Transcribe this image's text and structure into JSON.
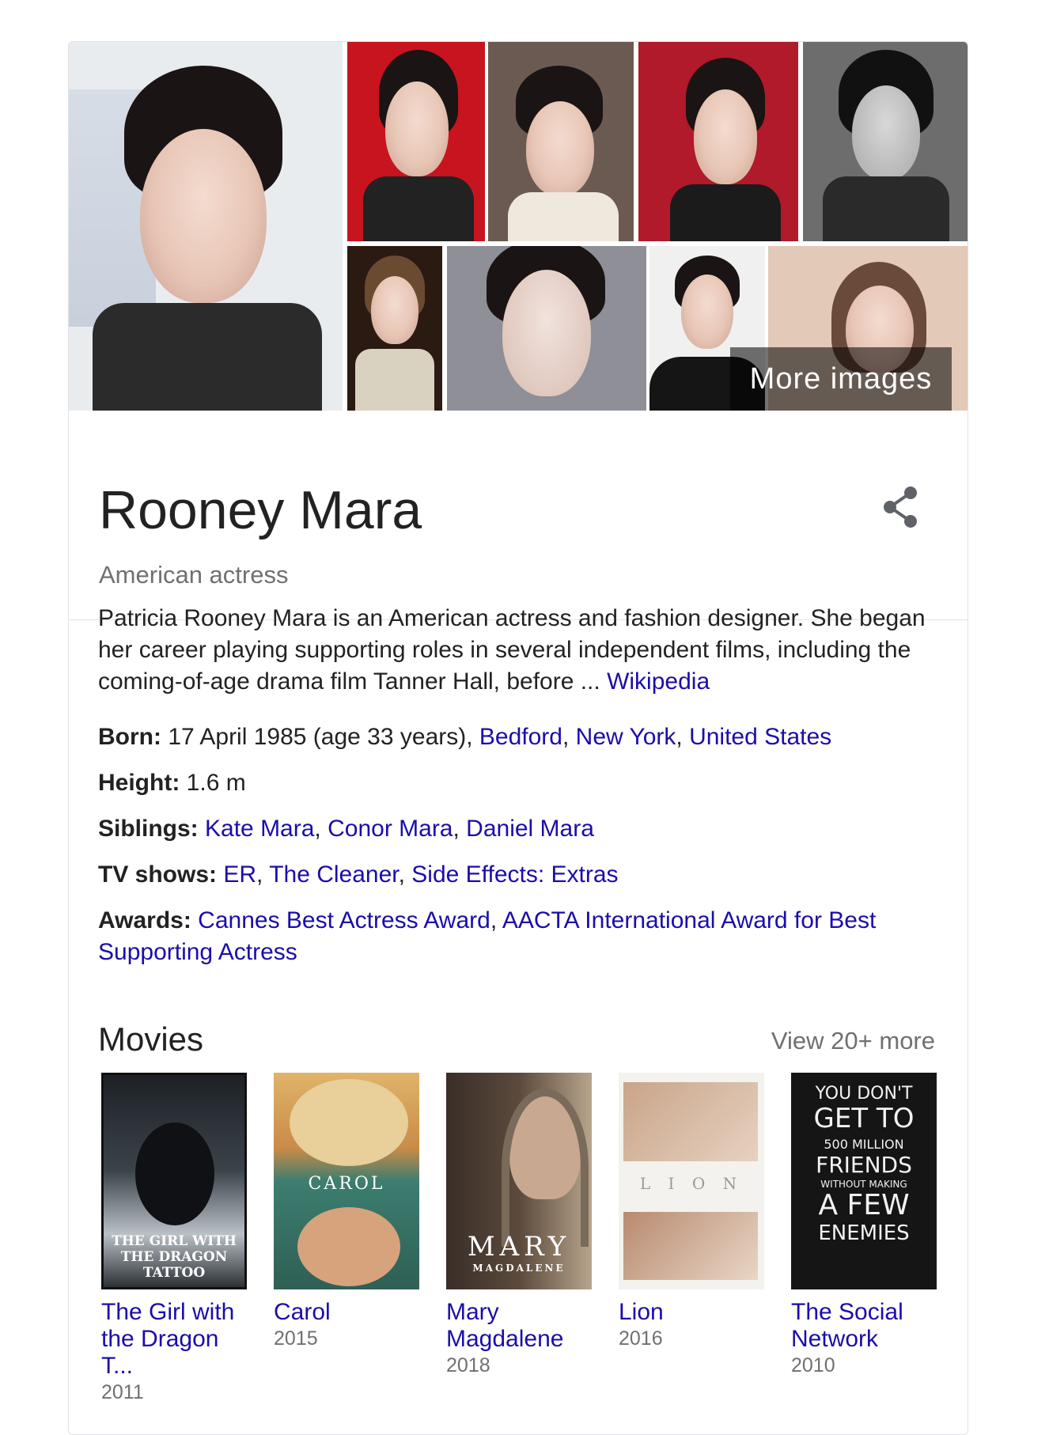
{
  "gallery": {
    "more_images_label": "More images"
  },
  "entity": {
    "name": "Rooney Mara",
    "subtitle": "American actress"
  },
  "description": {
    "text": "Patricia Rooney Mara is an American actress and fashion designer. She began her career playing supporting roles in several independent films, including the coming-of-age drama film Tanner Hall, before ... ",
    "source_link": "Wikipedia"
  },
  "facts": {
    "born": {
      "label": "Born:",
      "value": "17 April 1985 (age 33 years), ",
      "place_links": [
        "Bedford",
        "New York",
        "United States"
      ]
    },
    "height": {
      "label": "Height:",
      "value": "1.6 m"
    },
    "siblings": {
      "label": "Siblings:",
      "links": [
        "Kate Mara",
        "Conor Mara",
        "Daniel Mara"
      ]
    },
    "tv_shows": {
      "label": "TV shows:",
      "links": [
        "ER",
        "The Cleaner",
        "Side Effects: Extras"
      ]
    },
    "awards": {
      "label": "Awards:",
      "links": [
        "Cannes Best Actress Award",
        "AACTA International Award for Best Supporting Actress"
      ]
    }
  },
  "movies": {
    "heading": "Movies",
    "view_more": "View 20+ more",
    "items": [
      {
        "title": "The Girl with the Dragon T...",
        "year": "2011",
        "poster_text": "THE GIRL WITH THE DRAGON TATTOO"
      },
      {
        "title": "Carol",
        "year": "2015",
        "poster_text": "CAROL"
      },
      {
        "title": "Mary Magdalene",
        "year": "2018",
        "poster_text": "MARY",
        "poster_subtext": "MAGDALENE"
      },
      {
        "title": "Lion",
        "year": "2016",
        "poster_text": "L I O N"
      },
      {
        "title": "The Social Network",
        "year": "2010",
        "poster_lines": [
          "YOU DON'T",
          "GET TO",
          "500 MILLION",
          "FRIENDS",
          "WITHOUT MAKING",
          "A FEW",
          "ENEMIES"
        ]
      }
    ]
  },
  "colors": {
    "link": "#1a0dab",
    "secondary_text": "#707070",
    "border": "#dfe1e5"
  }
}
